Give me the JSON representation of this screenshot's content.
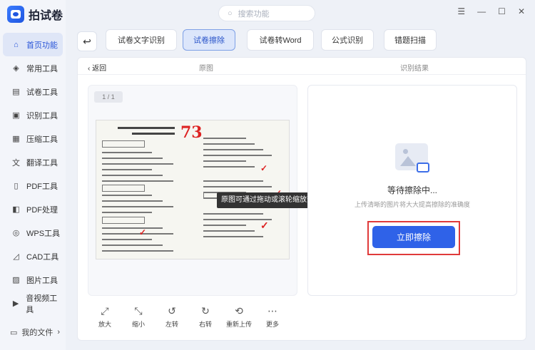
{
  "app": {
    "name": "拍试卷"
  },
  "search": {
    "placeholder": "搜索功能"
  },
  "window": {
    "menu_icon": "☰",
    "min_icon": "—",
    "max_icon": "☐",
    "close_icon": "✕"
  },
  "sidebar": {
    "items": [
      {
        "label": "首页功能",
        "icon": "home-icon",
        "glyph": "⌂"
      },
      {
        "label": "常用工具",
        "icon": "layers-icon",
        "glyph": "◈"
      },
      {
        "label": "试卷工具",
        "icon": "document-icon",
        "glyph": "▤"
      },
      {
        "label": "识别工具",
        "icon": "scan-icon",
        "glyph": "▣"
      },
      {
        "label": "压缩工具",
        "icon": "compress-icon",
        "glyph": "▦"
      },
      {
        "label": "翻译工具",
        "icon": "translate-icon",
        "glyph": "文"
      },
      {
        "label": "PDF工具",
        "icon": "pdf-icon",
        "glyph": "▯"
      },
      {
        "label": "PDF处理",
        "icon": "pdf-process-icon",
        "glyph": "◧"
      },
      {
        "label": "WPS工具",
        "icon": "wps-icon",
        "glyph": "◎"
      },
      {
        "label": "CAD工具",
        "icon": "cad-icon",
        "glyph": "◿"
      },
      {
        "label": "图片工具",
        "icon": "image-icon",
        "glyph": "▨"
      },
      {
        "label": "音视频工具",
        "icon": "media-icon",
        "glyph": "▶"
      }
    ],
    "my_files": "我的文件",
    "my_files_arrow": "›"
  },
  "tabs": [
    {
      "label": "试卷文字识别",
      "active": false
    },
    {
      "label": "试卷擦除",
      "active": true
    },
    {
      "label": "试卷转Word",
      "active": false
    },
    {
      "label": "公式识别",
      "active": false
    },
    {
      "label": "错题扫描",
      "active": false
    }
  ],
  "panel": {
    "back": "‹  返回",
    "original_label": "原图",
    "result_label": "识别结果",
    "page_count": "1 / 1",
    "tooltip": "原图可通过拖动或滚轮缩放查看",
    "tools": [
      {
        "label": "放大",
        "icon": "zoom-in-icon",
        "glyph": "⤢"
      },
      {
        "label": "缩小",
        "icon": "zoom-out-icon",
        "glyph": "⤡"
      },
      {
        "label": "左转",
        "icon": "rotate-left-icon",
        "glyph": "↺"
      },
      {
        "label": "右转",
        "icon": "rotate-right-icon",
        "glyph": "↻"
      },
      {
        "label": "重新上传",
        "icon": "reupload-icon",
        "glyph": "⟲"
      },
      {
        "label": "更多",
        "icon": "more-icon",
        "glyph": "⋯"
      }
    ],
    "waiting_text": "等待擦除中...",
    "hint_text": "上传清晰的图片将大大提高擦除的准确度",
    "erase_button": "立即擦除"
  },
  "paper": {
    "score": "73",
    "accent_red": "#d22222"
  },
  "colors": {
    "accent": "#2f62e8",
    "highlight": "#e03a3a"
  }
}
